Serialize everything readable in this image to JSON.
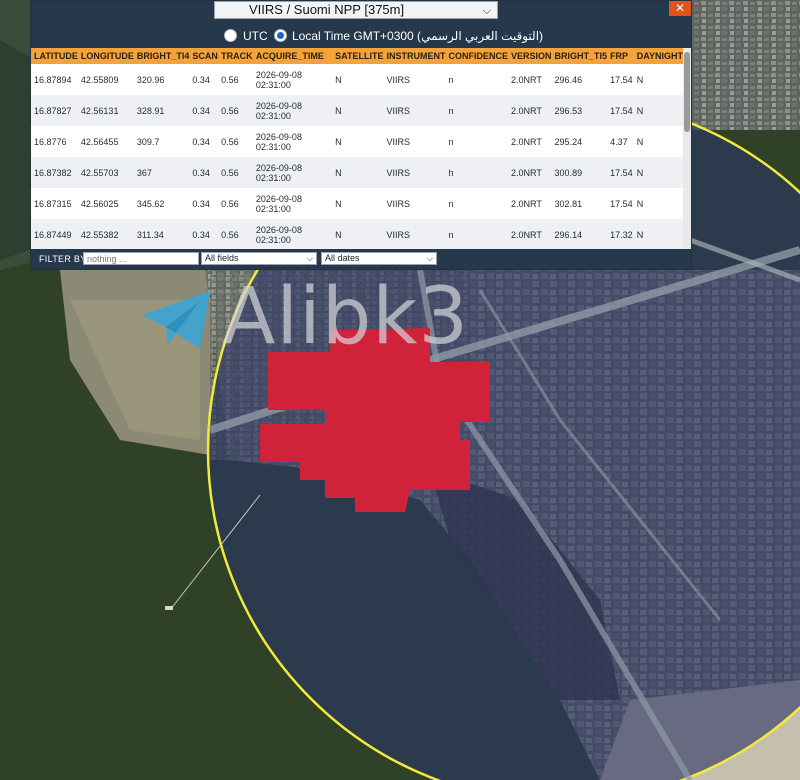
{
  "map": {
    "colors": {
      "sea": "#2f4228",
      "land": "#6f7569",
      "buffer_fill": "#2b3566",
      "buffer_stroke": "#f2ea3a",
      "fire": "#d0233a"
    },
    "watermark_text": "Alibk3",
    "watermark_icon": "telegram-icon"
  },
  "panel": {
    "satellite_select": "VIIRS / Suomi NPP [375m]",
    "close_label": "✕",
    "time_options": {
      "utc_label": "UTC",
      "local_label": "Local Time GMT+0300 (التوقيت العربي الرسمي)",
      "selected": "local"
    },
    "columns": [
      "LATITUDE",
      "LONGITUDE",
      "BRIGHT_TI4",
      "SCAN",
      "TRACK",
      "ACQUIRE_TIME",
      "SATELLITE",
      "INSTRUMENT",
      "CONFIDENCE",
      "VERSION",
      "BRIGHT_TI5",
      "FRP",
      "DAYNIGHT"
    ],
    "rows": [
      {
        "latitude": "16.87894",
        "longitude": "42.55809",
        "bright_ti4": "320.96",
        "scan": "0.34",
        "track": "0.56",
        "date": "2026-09-08",
        "time": "02:31:00",
        "satellite": "N",
        "instrument": "VIIRS",
        "confidence": "n",
        "version": "2.0NRT",
        "bright_ti5": "296.46",
        "frp": "17.54",
        "daynight": "N"
      },
      {
        "latitude": "16.87827",
        "longitude": "42.56131",
        "bright_ti4": "328.91",
        "scan": "0.34",
        "track": "0.56",
        "date": "2026-09-08",
        "time": "02:31:00",
        "satellite": "N",
        "instrument": "VIIRS",
        "confidence": "n",
        "version": "2.0NRT",
        "bright_ti5": "296.53",
        "frp": "17.54",
        "daynight": "N"
      },
      {
        "latitude": "16.8776",
        "longitude": "42.56455",
        "bright_ti4": "309.7",
        "scan": "0.34",
        "track": "0.56",
        "date": "2026-09-08",
        "time": "02:31:00",
        "satellite": "N",
        "instrument": "VIIRS",
        "confidence": "n",
        "version": "2.0NRT",
        "bright_ti5": "295.24",
        "frp": "4.37",
        "daynight": "N"
      },
      {
        "latitude": "16.87382",
        "longitude": "42.55703",
        "bright_ti4": "367",
        "scan": "0.34",
        "track": "0.56",
        "date": "2026-09-08",
        "time": "02:31:00",
        "satellite": "N",
        "instrument": "VIIRS",
        "confidence": "h",
        "version": "2.0NRT",
        "bright_ti5": "300.89",
        "frp": "17.54",
        "daynight": "N"
      },
      {
        "latitude": "16.87315",
        "longitude": "42.56025",
        "bright_ti4": "345.62",
        "scan": "0.34",
        "track": "0.56",
        "date": "2026-09-08",
        "time": "02:31:00",
        "satellite": "N",
        "instrument": "VIIRS",
        "confidence": "n",
        "version": "2.0NRT",
        "bright_ti5": "302.81",
        "frp": "17.54",
        "daynight": "N"
      },
      {
        "latitude": "16.87449",
        "longitude": "42.55382",
        "bright_ti4": "311.34",
        "scan": "0.34",
        "track": "0.56",
        "date": "2026-09-08",
        "time": "02:31:00",
        "satellite": "N",
        "instrument": "VIIRS",
        "confidence": "n",
        "version": "2.0NRT",
        "bright_ti5": "296.14",
        "frp": "17.32",
        "daynight": "N"
      }
    ],
    "filter": {
      "label": "FILTER BY",
      "placeholder": "nothing ...",
      "fields_value": "All fields",
      "dates_value": "All dates"
    }
  }
}
